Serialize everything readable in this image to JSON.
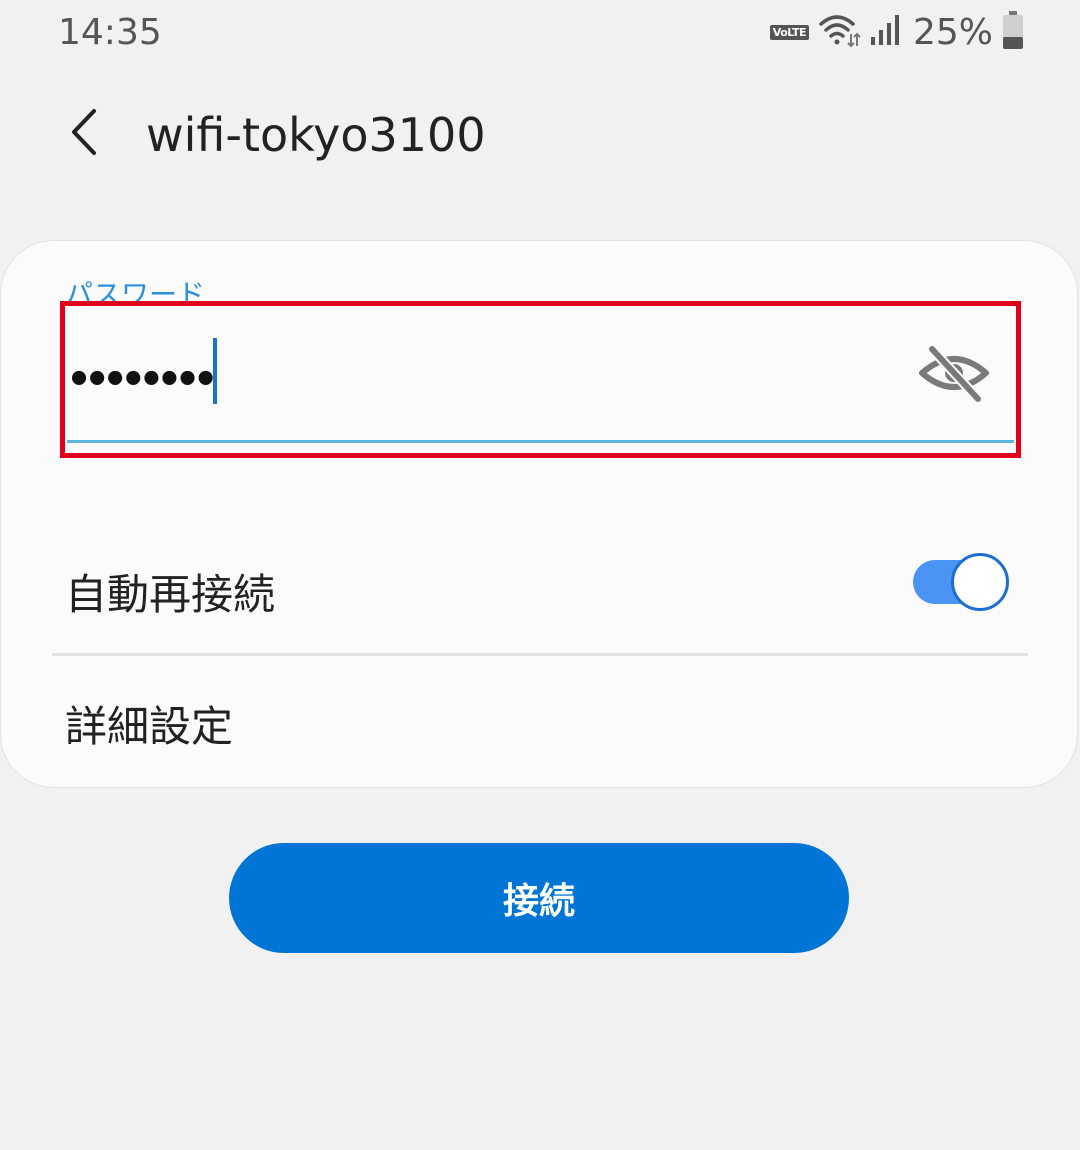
{
  "status_bar": {
    "time": "14:35",
    "volte_label": "VoLTE",
    "battery_percent": "25%",
    "battery_level": 0.25,
    "icons": [
      "volte-icon",
      "wifi-icon",
      "cellular-signal-icon",
      "battery-icon"
    ]
  },
  "header": {
    "back_icon": "chevron-left-icon",
    "title": "wifi-tokyo3100"
  },
  "password": {
    "label": "パスワード",
    "masked_value": "••••••••",
    "visibility_icon": "eye-off-icon",
    "highlight_color": "#e0001b"
  },
  "auto_reconnect": {
    "label": "自動再接続",
    "enabled": true
  },
  "advanced": {
    "label": "詳細設定"
  },
  "connect_button": {
    "label": "接続"
  },
  "colors": {
    "accent": "#0075d5",
    "label_blue": "#2a8fde",
    "toggle_track": "#4a95f3",
    "background": "#f1f1f1",
    "card": "#fbfbfb"
  }
}
